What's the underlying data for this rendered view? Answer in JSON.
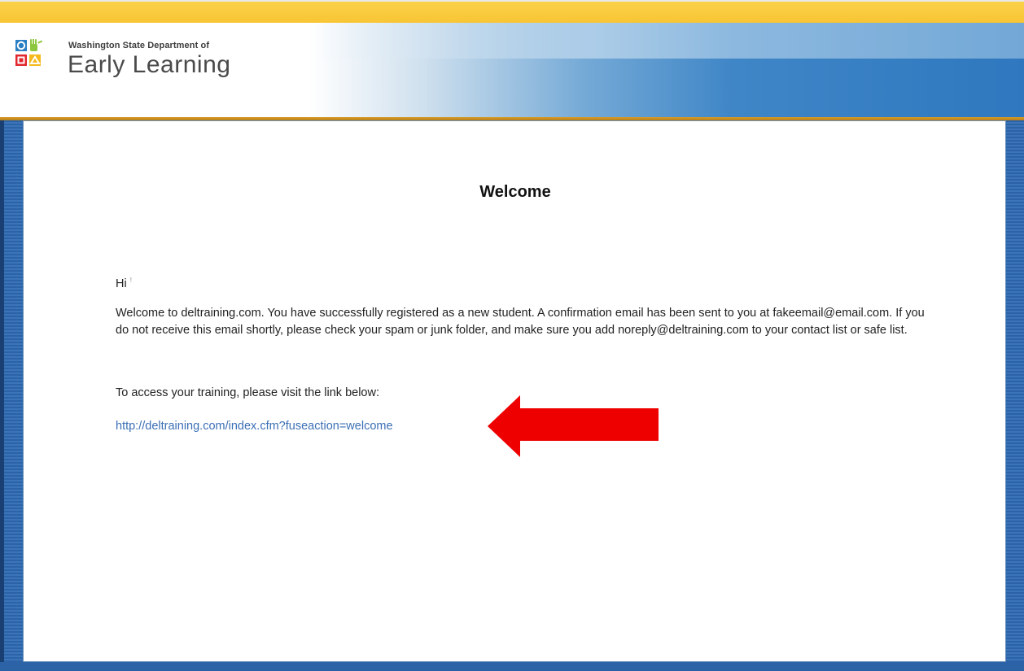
{
  "header": {
    "logo_small": "Washington State Department of",
    "logo_big": "Early Learning"
  },
  "content": {
    "title": "Welcome",
    "greeting": "Hi",
    "greeting_mark": "!",
    "welcome_paragraph": "Welcome to deltraining.com. You have successfully registered as a new student. A confirmation email has been sent to you at fakeemail@email.com. If you do not receive this email shortly, please check your spam or junk folder, and make sure you add noreply@deltraining.com to your contact list or safe list.",
    "access_line": "To access your training, please visit the link below:",
    "link_text": "http://deltraining.com/index.cfm?fuseaction=welcome"
  },
  "colors": {
    "top_strip": "#f8c534",
    "frame_blue": "#2c63a7",
    "link_blue": "#3b6fb5",
    "arrow_red": "#ee0000",
    "logo_blue": "#2a7fc4",
    "logo_green": "#8dc63f",
    "logo_red": "#e2262e",
    "logo_yellow": "#f6b91c"
  },
  "icons": {
    "logo_mark": "circle-hand-square-triangle-logo-icon",
    "annotation": "red-arrow-left-icon"
  }
}
